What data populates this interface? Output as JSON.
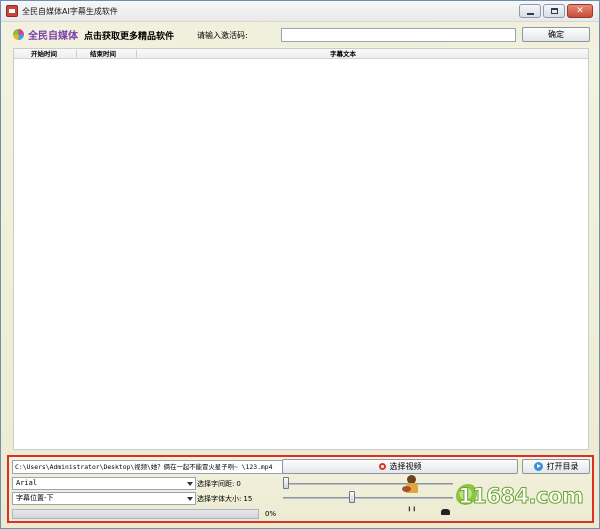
{
  "window": {
    "title": "全民自媒体AI字幕生成软件",
    "controls": {
      "minimize": "",
      "maximize": "",
      "close": "✕"
    }
  },
  "topbar": {
    "logo_text": "全民自媒体",
    "promo_link": "点击获取更多精品软件",
    "code_label": "请输入激活码:",
    "code_value": "",
    "confirm_label": "确定"
  },
  "table": {
    "columns": [
      "开始时间",
      "结束时间",
      "字幕文本"
    ],
    "rows": []
  },
  "bottom": {
    "video_path": "C:\\Users\\Administrator\\Desktop\\视频\\她？俩在一起不能冒火星子咧~ \\123.mp4",
    "select_video_label": "选择视频",
    "open_dir_label": "打开目录",
    "font_value": "Arial",
    "position_value": "字幕位置-下",
    "spacing_label": "选择字间距:",
    "spacing_value": "0",
    "size_label": "选择字体大小:",
    "size_value": "15",
    "spacing_slider": 0,
    "size_slider": 0.4,
    "progress": 0,
    "progress_text": "0%",
    "legs_glyph": "╹╹"
  },
  "watermark": {
    "text": "11684.com"
  },
  "colors": {
    "highlight_border": "#d9312a",
    "logo_purple": "#7b3fa8",
    "progress_green": "#5ab04a",
    "watermark_green": "#8cc63f"
  },
  "icons": [
    "app-icon",
    "minimize-icon",
    "maximize-icon",
    "close-icon",
    "logo-icon",
    "record-icon",
    "play-icon",
    "dropdown-arrow-icon"
  ]
}
